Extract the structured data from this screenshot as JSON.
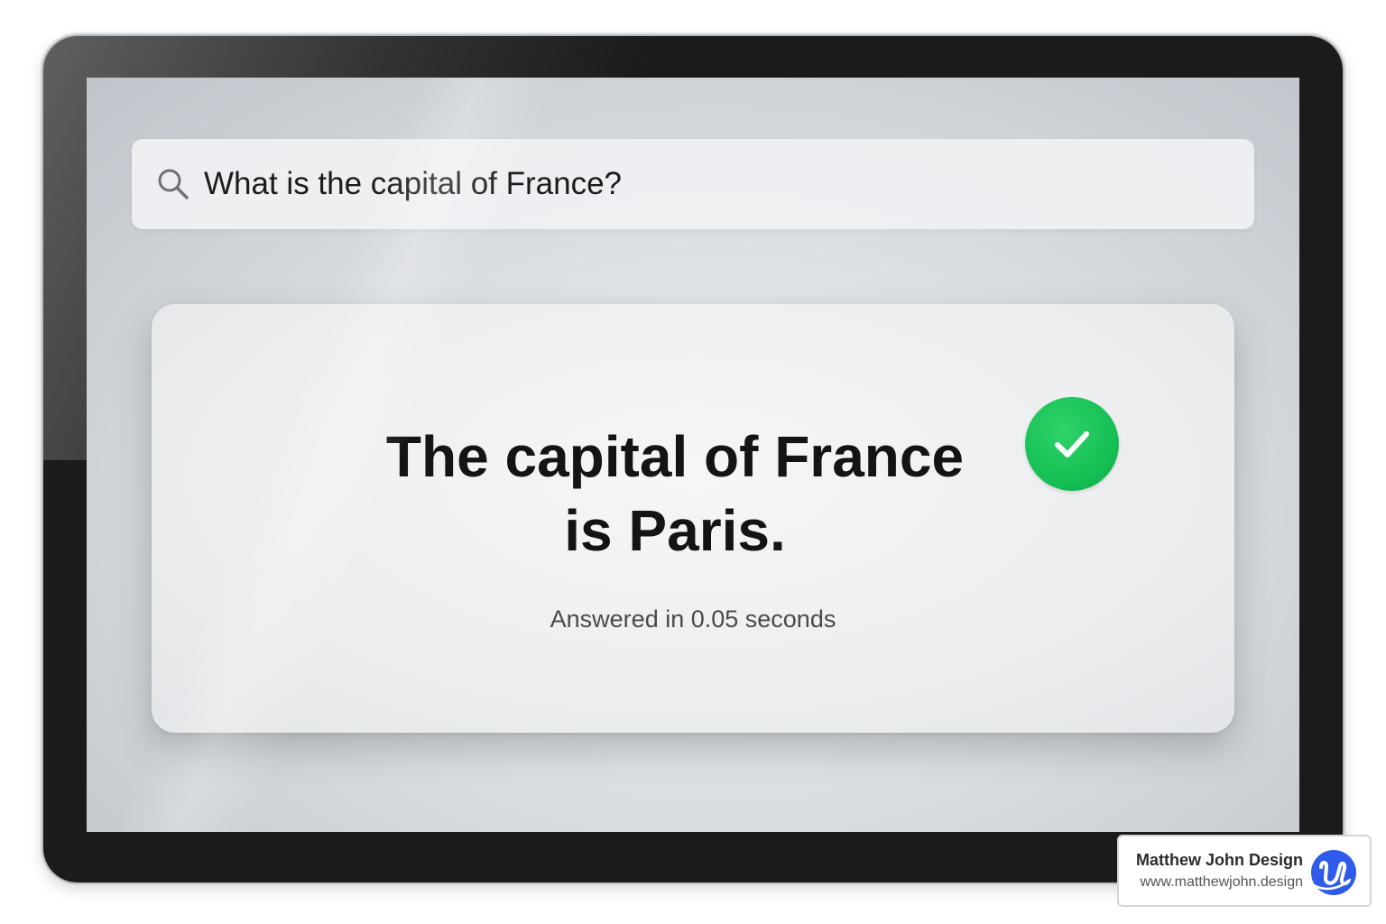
{
  "search": {
    "query": "What is the capital of France?",
    "icon": "search-icon"
  },
  "answer": {
    "line1": "The capital of France",
    "line2": "is Paris.",
    "status_icon": "check-icon",
    "status_color": "#16c055",
    "meta": "Answered in 0.05 seconds"
  },
  "watermark": {
    "name": "Matthew John Design",
    "url": "www.matthewjohn.design",
    "logo_color": "#2f5bea"
  }
}
